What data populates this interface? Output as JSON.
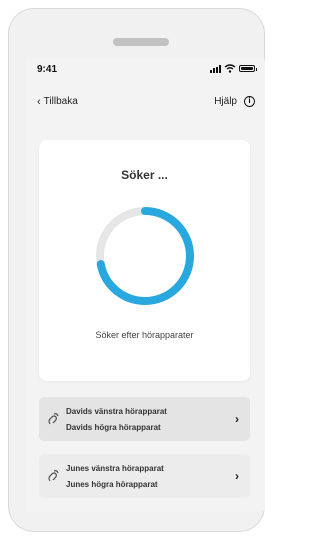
{
  "status_bar": {
    "time": "9:41"
  },
  "nav": {
    "back_label": "Tillbaka",
    "help_label": "Hjälp"
  },
  "search": {
    "title": "Söker ...",
    "status": "Söker efter hörapparater",
    "progress": 0.72,
    "progress_color": "#29a8df",
    "track_color": "#e6e6e6"
  },
  "devices": [
    {
      "left_name": "Davids vänstra hörapparat",
      "right_name": "Davids högra hörapparat"
    },
    {
      "left_name": "Junes vänstra hörapparat",
      "right_name": "Junes högra hörapparat"
    }
  ]
}
